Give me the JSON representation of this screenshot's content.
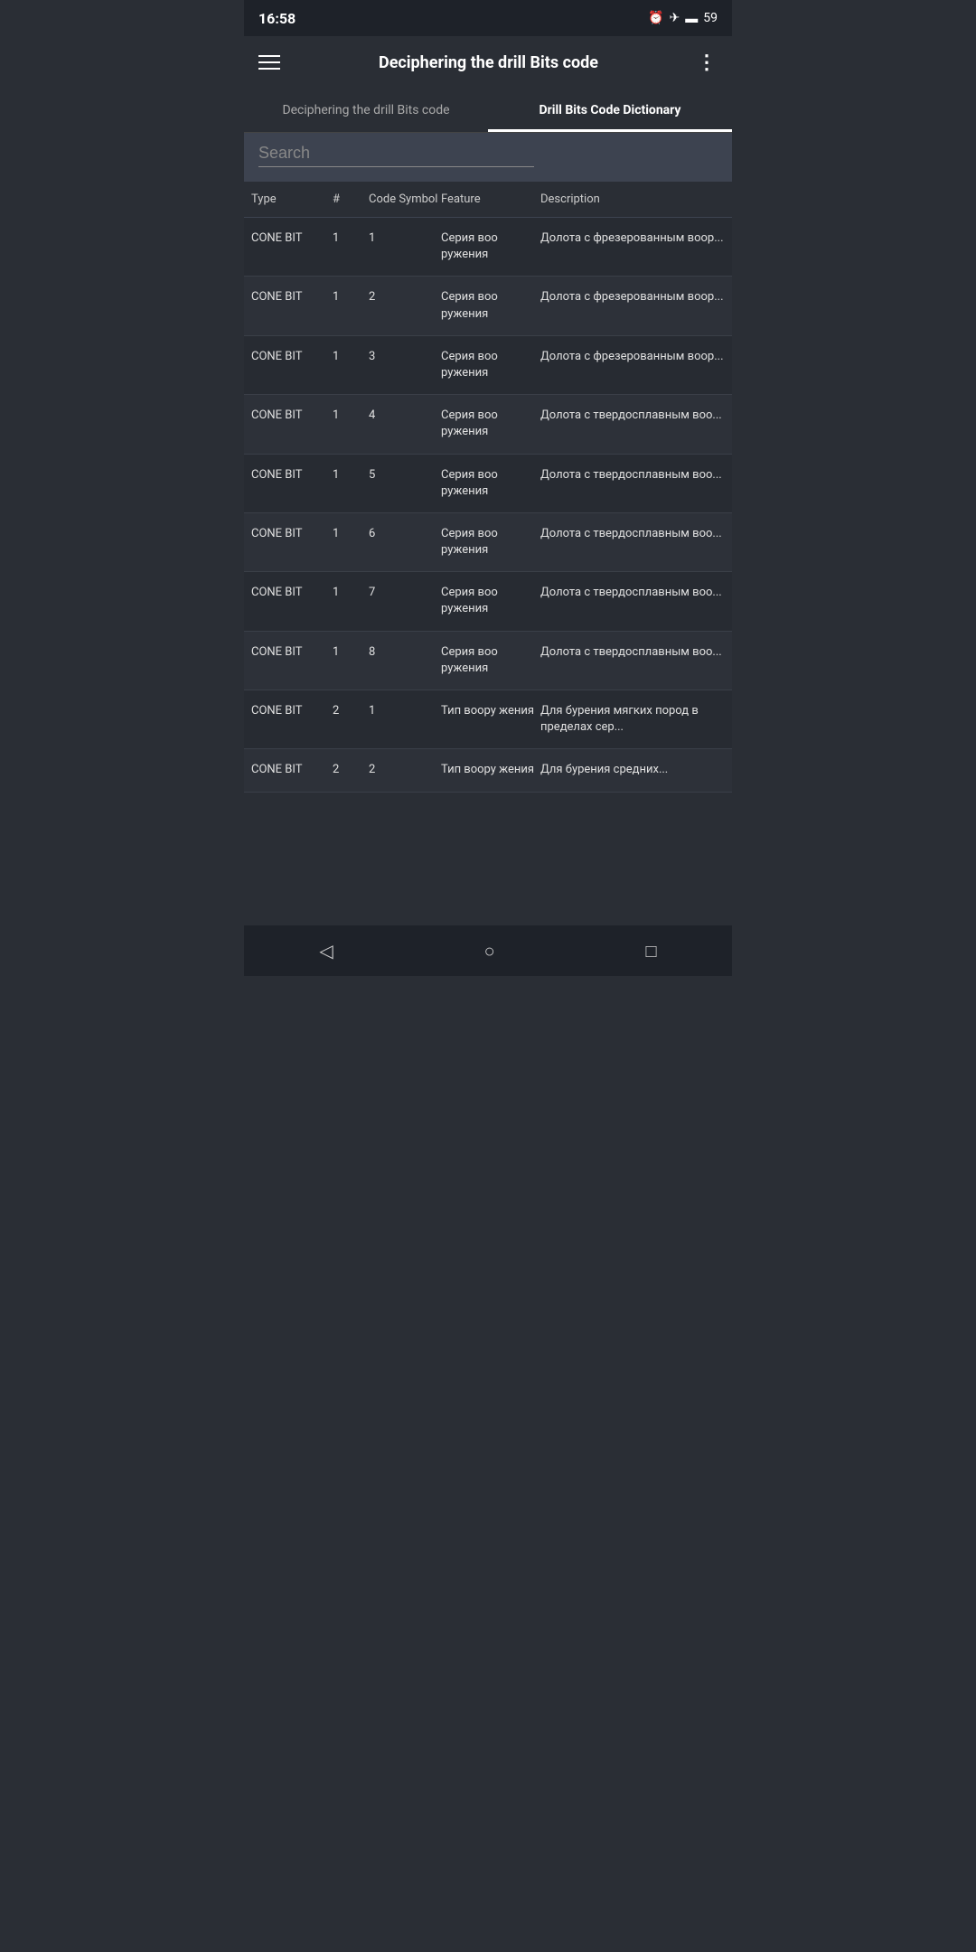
{
  "statusBar": {
    "time": "16:58",
    "battery": "59"
  },
  "appBar": {
    "title": "Deciphering the drill Bits code",
    "menuIcon": "≡",
    "moreIcon": "⋮"
  },
  "tabs": [
    {
      "id": "tab1",
      "label": "Deciphering the drill Bits code",
      "active": false
    },
    {
      "id": "tab2",
      "label": "Drill Bits Code Dictionary",
      "active": true
    }
  ],
  "search": {
    "placeholder": "Search"
  },
  "tableHeaders": [
    {
      "id": "type",
      "label": "Type"
    },
    {
      "id": "num",
      "label": "#"
    },
    {
      "id": "code",
      "label": "Code Symbol"
    },
    {
      "id": "feature",
      "label": "Feature"
    },
    {
      "id": "desc",
      "label": "Description"
    }
  ],
  "tableRows": [
    {
      "type": "CONE BIT",
      "num": "1",
      "code": "1",
      "feature": "Серия воо ружения",
      "desc": "Долота с фрезерованным воор..."
    },
    {
      "type": "CONE BIT",
      "num": "1",
      "code": "2",
      "feature": "Серия воо ружения",
      "desc": "Долота с фрезерованным воор..."
    },
    {
      "type": "CONE BIT",
      "num": "1",
      "code": "3",
      "feature": "Серия воо ружения",
      "desc": "Долота с фрезерованным воор..."
    },
    {
      "type": "CONE BIT",
      "num": "1",
      "code": "4",
      "feature": "Серия воо ружения",
      "desc": "Долота с твердосплавным воо..."
    },
    {
      "type": "CONE BIT",
      "num": "1",
      "code": "5",
      "feature": "Серия воо ружения",
      "desc": "Долота с твердосплавным воо..."
    },
    {
      "type": "CONE BIT",
      "num": "1",
      "code": "6",
      "feature": "Серия воо ружения",
      "desc": "Долота с твердосплавным воо..."
    },
    {
      "type": "CONE BIT",
      "num": "1",
      "code": "7",
      "feature": "Серия воо ружения",
      "desc": "Долота с твердосплавным воо..."
    },
    {
      "type": "CONE BIT",
      "num": "1",
      "code": "8",
      "feature": "Серия воо ружения",
      "desc": "Долота с твердосплавным воо..."
    },
    {
      "type": "CONE BIT",
      "num": "2",
      "code": "1",
      "feature": "Тип воору жения",
      "desc": "Для бурения мягких пород в пределах сер..."
    },
    {
      "type": "CONE BIT",
      "num": "2",
      "code": "2",
      "feature": "Тип воору жения",
      "desc": "Для бурения средних..."
    }
  ],
  "bottomNav": {
    "backIcon": "◁",
    "homeIcon": "○",
    "recentIcon": "□"
  }
}
